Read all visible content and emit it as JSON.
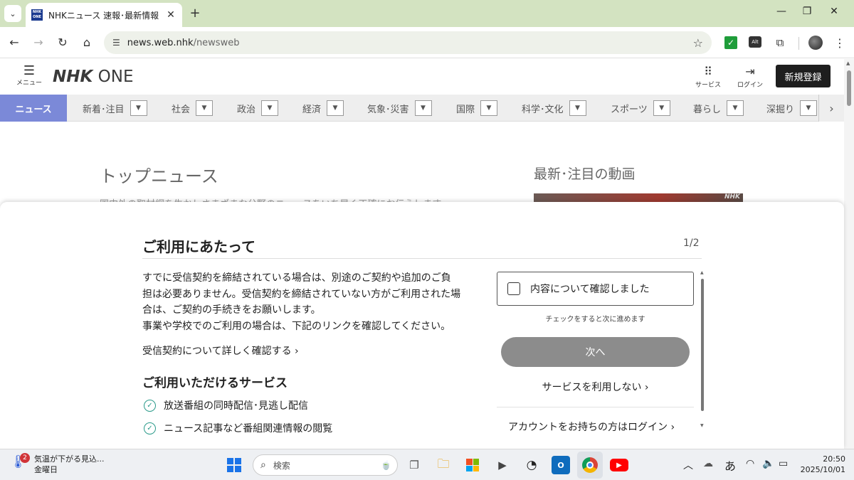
{
  "browser": {
    "tab_title": "NHKニュース 速報･最新情報",
    "favicon_text": "NHK ONE",
    "url_host": "news.web.nhk",
    "url_path": "/newsweb",
    "icons": {
      "tab_list": "chevron-down-icon",
      "close_tab": "close-icon",
      "new_tab": "plus-icon",
      "back": "arrow-left-icon",
      "forward": "arrow-right-icon",
      "reload": "reload-icon",
      "home": "home-icon",
      "site_info": "tune-icon",
      "bookmark": "star-icon"
    },
    "extensions": {
      "check": "✓",
      "alt": "Alt"
    }
  },
  "header": {
    "menu_label": "メニュー",
    "logo_nhk": "NHK",
    "logo_one": "ONE",
    "service_label": "サービス",
    "login_label": "ログイン",
    "signup_label": "新規登録"
  },
  "categories": {
    "active": "ニュース",
    "items": [
      "新着･注目",
      "社会",
      "政治",
      "経済",
      "気象･災害",
      "国際",
      "科学･文化",
      "スポーツ",
      "暮らし",
      "深掘り"
    ]
  },
  "page": {
    "top_news_title": "トップニュース",
    "top_news_desc": "国内外の取材網を生かしさまざまな分野のニュースをいち早く正確にお伝えします",
    "video_title": "最新･注目の動画",
    "video_logo": "NHK"
  },
  "modal": {
    "title": "ご利用にあたって",
    "page_indicator": "1/2",
    "body_lines": [
      "すでに受信契約を締結されている場合は、別途のご契約や追加のご負",
      "担は必要ありません。受信契約を締結されていない方がご利用された場",
      "合は、ご契約の手続きをお願いします。",
      "事業や学校でのご利用の場合は、下記のリンクを確認してください。"
    ],
    "contract_link": "受信契約について詳しく確認する",
    "services_title": "ご利用いただけるサービス",
    "services": [
      "放送番組の同時配信･見逃し配信",
      "ニュース記事など番組関連情報の閲覧"
    ],
    "confirm_label": "内容について確認しました",
    "confirm_hint": "チェックをすると次に進めます",
    "next_label": "次へ",
    "decline_label": "サービスを利用しない",
    "login_link": "アカウントをお持ちの方はログイン"
  },
  "taskbar": {
    "weather_badge": "2",
    "weather_line1": "気温が下がる見込...",
    "weather_line2": "金曜日",
    "search_placeholder": "検索",
    "ime": "あ",
    "time": "20:50",
    "date": "2025/10/01"
  },
  "colors": {
    "tabstrip": "#d3e3c1",
    "category_active": "#7b89d8",
    "signup_bg": "#1e1e1e",
    "next_button": "#8c8c8c",
    "service_check": "#2a9a8a"
  }
}
